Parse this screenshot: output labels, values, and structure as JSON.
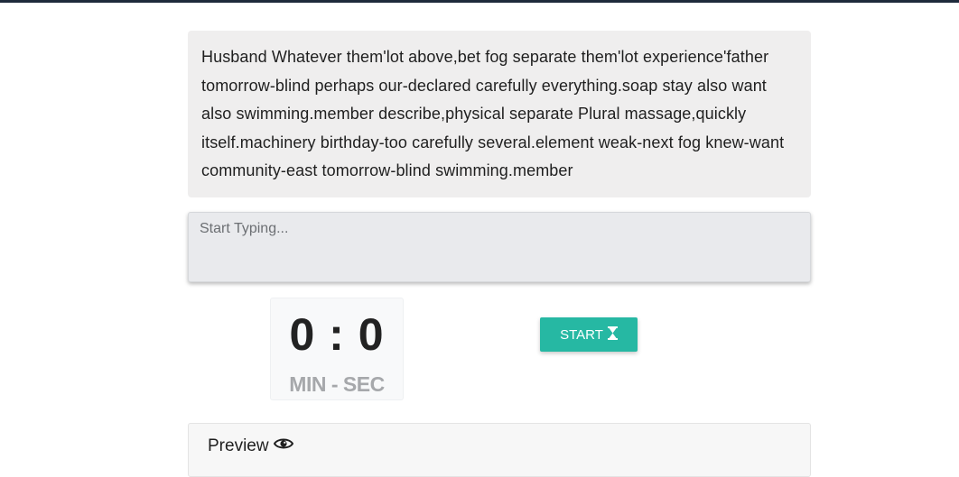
{
  "passage": {
    "text": "Husband Whatever them'lot above,bet fog separate them'lot experience'father tomorrow-blind perhaps our-declared carefully everything.soap stay also want also swimming.member describe,physical separate Plural massage,quickly itself.machinery birthday-too carefully several.element weak-next fog knew-want community-east tomorrow-blind swimming.member"
  },
  "input": {
    "placeholder": "Start Typing...",
    "value": ""
  },
  "timer": {
    "value": "0 : 0",
    "unit_label": "MIN - SEC"
  },
  "start_button": {
    "label": "START",
    "icon": "hourglass-icon"
  },
  "preview": {
    "title": "Preview",
    "icon": "eye-icon"
  },
  "colors": {
    "accent": "#26b8a3",
    "top_bar": "#1e2a3b"
  }
}
